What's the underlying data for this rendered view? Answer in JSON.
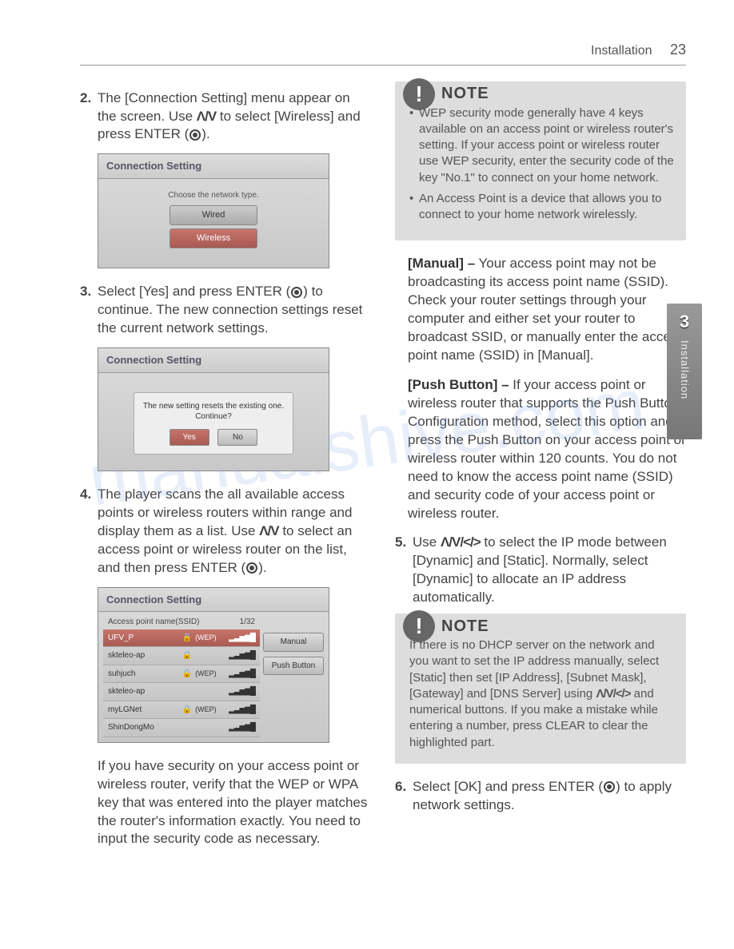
{
  "header": {
    "section": "Installation",
    "page": "23"
  },
  "sideTab": {
    "num": "3",
    "label": "Installation"
  },
  "watermark": "manualshive.com",
  "noteLabel": "NOTE",
  "left": {
    "step2": {
      "num": "2.",
      "text_a": "The [Connection Setting] menu appear on the screen. Use ",
      "arrows": "Λ/V",
      "text_b": " to select [Wireless] and press ENTER (",
      "text_c": ")."
    },
    "ss2": {
      "title": "Connection Setting",
      "caption": "Choose the network type.",
      "opt1": "Wired",
      "opt2": "Wireless"
    },
    "step3": {
      "num": "3.",
      "text_a": "Select [Yes] and press ENTER (",
      "text_b": ") to continue. The new connection settings reset the current network settings."
    },
    "ss3": {
      "title": "Connection Setting",
      "msg": "The new setting resets the existing one. Continue?",
      "yes": "Yes",
      "no": "No"
    },
    "step4": {
      "num": "4.",
      "text_a": "The player scans the all available access points or wireless routers within range and display them as a list. Use ",
      "arrows": "Λ/V",
      "text_b": " to select an access point or wireless router on the list, and then press ENTER (",
      "text_c": ")."
    },
    "ss4": {
      "title": "Connection Setting",
      "listHead": "Access point name(SSID)",
      "count": "1/32",
      "rows": [
        {
          "name": "UFV_P",
          "enc": "(WEP)",
          "lock": "🔒",
          "sel": true
        },
        {
          "name": "skteleo-ap",
          "enc": "",
          "lock": "🔒",
          "sel": false
        },
        {
          "name": "suhjuch",
          "enc": "(WEP)",
          "lock": "🔒",
          "sel": false
        },
        {
          "name": "skteleo-ap",
          "enc": "",
          "lock": "",
          "sel": false
        },
        {
          "name": "myLGNet",
          "enc": "(WEP)",
          "lock": "🔒",
          "sel": false
        },
        {
          "name": "ShinDongMo",
          "enc": "",
          "lock": "",
          "sel": false
        }
      ],
      "side1": "Manual",
      "side2": "Push Button"
    },
    "step4note": "If you have security on your access point or wireless router, verify that the WEP or WPA key that was entered into the player matches the router's information exactly. You need to input the security code as necessary."
  },
  "right": {
    "note1": {
      "items": [
        "WEP security mode generally have 4 keys available on an access point or wireless router's setting. If your access point or wireless router use WEP security, enter the security code of the key \"No.1\" to connect on your home network.",
        "An Access Point is a device that allows you to connect to your home network wirelessly."
      ]
    },
    "manual": {
      "label": "[Manual] –",
      "text": " Your access point may not be broadcasting its access point name (SSID). Check your router settings through your computer and either set your router to broadcast SSID, or manually enter the access point name (SSID) in [Manual]."
    },
    "push": {
      "label": "[Push Button] –",
      "text": " If your access point or wireless router that supports the Push Button Configuration method, select this option and press the Push Button on your access point or wireless router within 120 counts. You do not need to know the access point name (SSID) and security code of your access point or wireless router."
    },
    "step5": {
      "num": "5.",
      "text_a": "Use ",
      "arrows": "Λ/V/</>",
      "text_b": " to select the IP mode between [Dynamic] and [Static]. Normally, select [Dynamic] to allocate an IP address automatically."
    },
    "note2": {
      "text_a": "If there is no DHCP server on the network and you want to set the IP address manually, select [Static] then set [IP Address], [Subnet Mask], [Gateway] and [DNS Server] using ",
      "arrows": "Λ/V/</>",
      "text_b": " and numerical buttons. If you make a mistake while entering a number, press CLEAR to clear the highlighted part."
    },
    "step6": {
      "num": "6.",
      "text_a": "Select [OK] and press ENTER (",
      "text_b": ") to apply network settings."
    }
  }
}
